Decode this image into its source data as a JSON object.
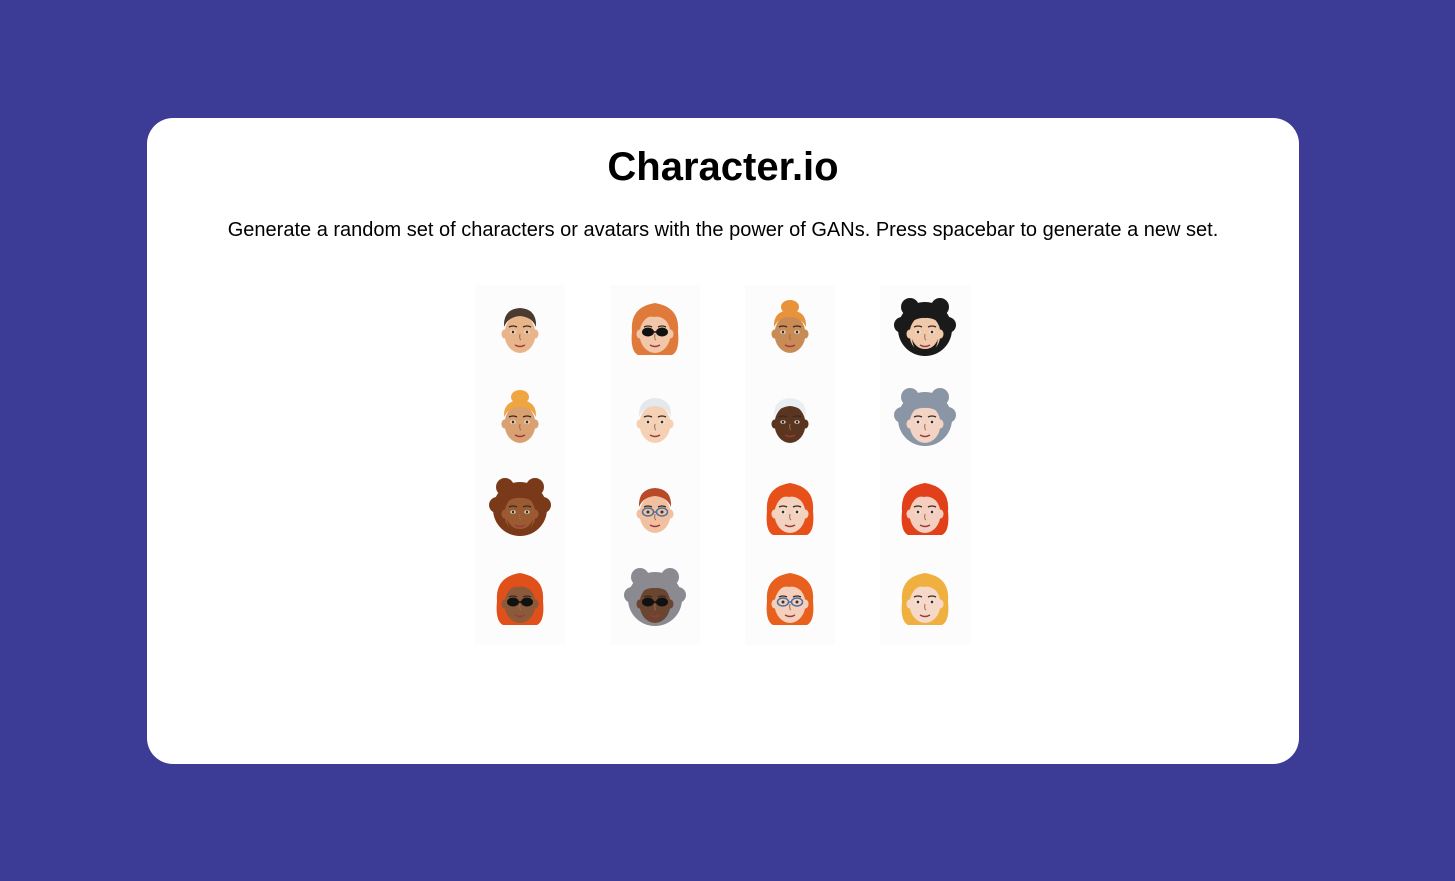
{
  "app": {
    "title": "Character.io",
    "subtitle": "Generate a random set of characters or avatars with the power of GANs. Press spacebar to generate a new set."
  },
  "colors": {
    "background": "#3c3b96",
    "card": "#ffffff"
  },
  "avatars": [
    {
      "name": "avatar-1-1",
      "skin": "#e8b58a",
      "hair": "#4a3a30",
      "hair_style": "short",
      "glasses": "none",
      "beard": false
    },
    {
      "name": "avatar-1-2",
      "skin": "#f2c6a8",
      "hair": "#e07a3a",
      "hair_style": "long",
      "glasses": "sunglasses",
      "beard": false
    },
    {
      "name": "avatar-1-3",
      "skin": "#c98b55",
      "hair": "#e8923a",
      "hair_style": "bun",
      "glasses": "none",
      "beard": false
    },
    {
      "name": "avatar-1-4",
      "skin": "#f0c8aa",
      "hair": "#1a1a1a",
      "hair_style": "curly",
      "glasses": "none",
      "beard": true
    },
    {
      "name": "avatar-2-1",
      "skin": "#d9a072",
      "hair": "#f0a640",
      "hair_style": "bun",
      "glasses": "none",
      "beard": false
    },
    {
      "name": "avatar-2-2",
      "skin": "#f4d0b4",
      "hair": "#e4e8ec",
      "hair_style": "short",
      "glasses": "none",
      "beard": false
    },
    {
      "name": "avatar-2-3",
      "skin": "#5a3520",
      "hair": "#e9eef2",
      "hair_style": "short",
      "glasses": "none",
      "beard": false
    },
    {
      "name": "avatar-2-4",
      "skin": "#f3d3c4",
      "hair": "#8a96a6",
      "hair_style": "curly",
      "glasses": "none",
      "beard": false
    },
    {
      "name": "avatar-3-1",
      "skin": "#9a5a32",
      "hair": "#7a3a1a",
      "hair_style": "curly",
      "glasses": "none",
      "beard": true
    },
    {
      "name": "avatar-3-2",
      "skin": "#f0c0a0",
      "hair": "#b84a2a",
      "hair_style": "short",
      "glasses": "clear",
      "beard": false
    },
    {
      "name": "avatar-3-3",
      "skin": "#f4d2c0",
      "hair": "#e8501a",
      "hair_style": "long",
      "glasses": "none",
      "beard": false
    },
    {
      "name": "avatar-3-4",
      "skin": "#f4cfc0",
      "hair": "#e2401a",
      "hair_style": "long",
      "glasses": "none",
      "beard": false
    },
    {
      "name": "avatar-4-1",
      "skin": "#8a5a3a",
      "hair": "#e0501a",
      "hair_style": "long",
      "glasses": "sunglasses",
      "beard": false
    },
    {
      "name": "avatar-4-2",
      "skin": "#6a4530",
      "hair": "#8a8a90",
      "hair_style": "curly",
      "glasses": "sunglasses",
      "beard": false
    },
    {
      "name": "avatar-4-3",
      "skin": "#f4d0bc",
      "hair": "#e8601e",
      "hair_style": "long",
      "glasses": "clear",
      "beard": false
    },
    {
      "name": "avatar-4-4",
      "skin": "#f6d8c8",
      "hair": "#f0b040",
      "hair_style": "long",
      "glasses": "none",
      "beard": false
    }
  ]
}
